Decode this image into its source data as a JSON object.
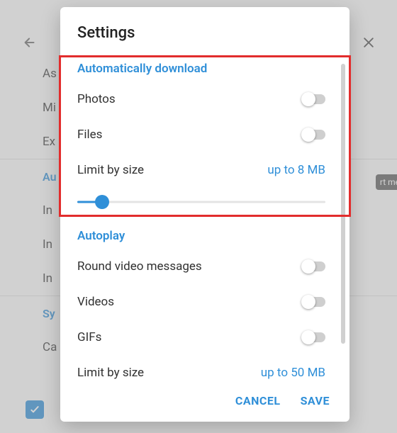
{
  "background": {
    "rows": [
      "As",
      "Mi",
      "Ex"
    ],
    "section1_head": "Au",
    "rows2": [
      "In",
      "In",
      "In"
    ],
    "section2_head": "Sy",
    "row3": "Ca",
    "badge": "rt me"
  },
  "dialog": {
    "title": "Settings",
    "sections": [
      {
        "title": "Automatically download",
        "items": [
          {
            "label": "Photos",
            "type": "toggle",
            "on": false
          },
          {
            "label": "Files",
            "type": "toggle",
            "on": false
          },
          {
            "label": "Limit by size",
            "type": "size",
            "value": "up to 8 MB",
            "slider_pct": 10
          }
        ]
      },
      {
        "title": "Autoplay",
        "items": [
          {
            "label": "Round video messages",
            "type": "toggle",
            "on": false
          },
          {
            "label": "Videos",
            "type": "toggle",
            "on": false
          },
          {
            "label": "GIFs",
            "type": "toggle",
            "on": false
          },
          {
            "label": "Limit by size",
            "type": "size",
            "value": "up to 50 MB"
          }
        ]
      }
    ],
    "actions": {
      "cancel": "CANCEL",
      "save": "SAVE"
    }
  }
}
